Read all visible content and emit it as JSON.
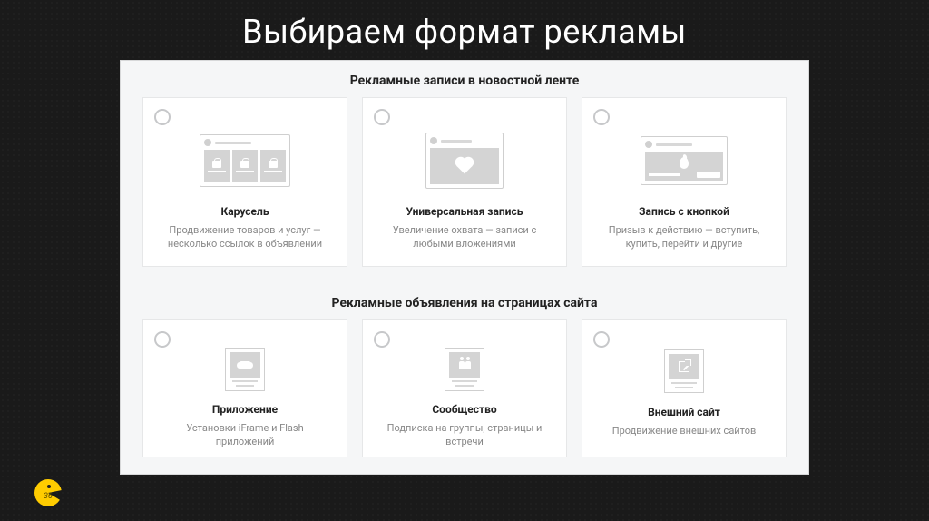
{
  "slide": {
    "title": "Выбираем формат рекламы",
    "page_number": "36"
  },
  "section1": {
    "title": "Рекламные записи в новостной ленте",
    "cards": [
      {
        "title": "Карусель",
        "desc": "Продвижение товаров и услуг — несколько ссылок в объявлении"
      },
      {
        "title": "Универсальная запись",
        "desc": "Увеличение охвата — записи с любыми вложениями"
      },
      {
        "title": "Запись с кнопкой",
        "desc": "Призыв к действию — вступить, купить, перейти и другие"
      }
    ]
  },
  "section2": {
    "title": "Рекламные объявления на страницах сайта",
    "cards": [
      {
        "title": "Приложение",
        "desc": "Установки iFrame и Flash приложений"
      },
      {
        "title": "Сообщество",
        "desc": "Подписка на группы, страницы и встречи"
      },
      {
        "title": "Внешний сайт",
        "desc": "Продвижение внешних сайтов"
      }
    ]
  }
}
